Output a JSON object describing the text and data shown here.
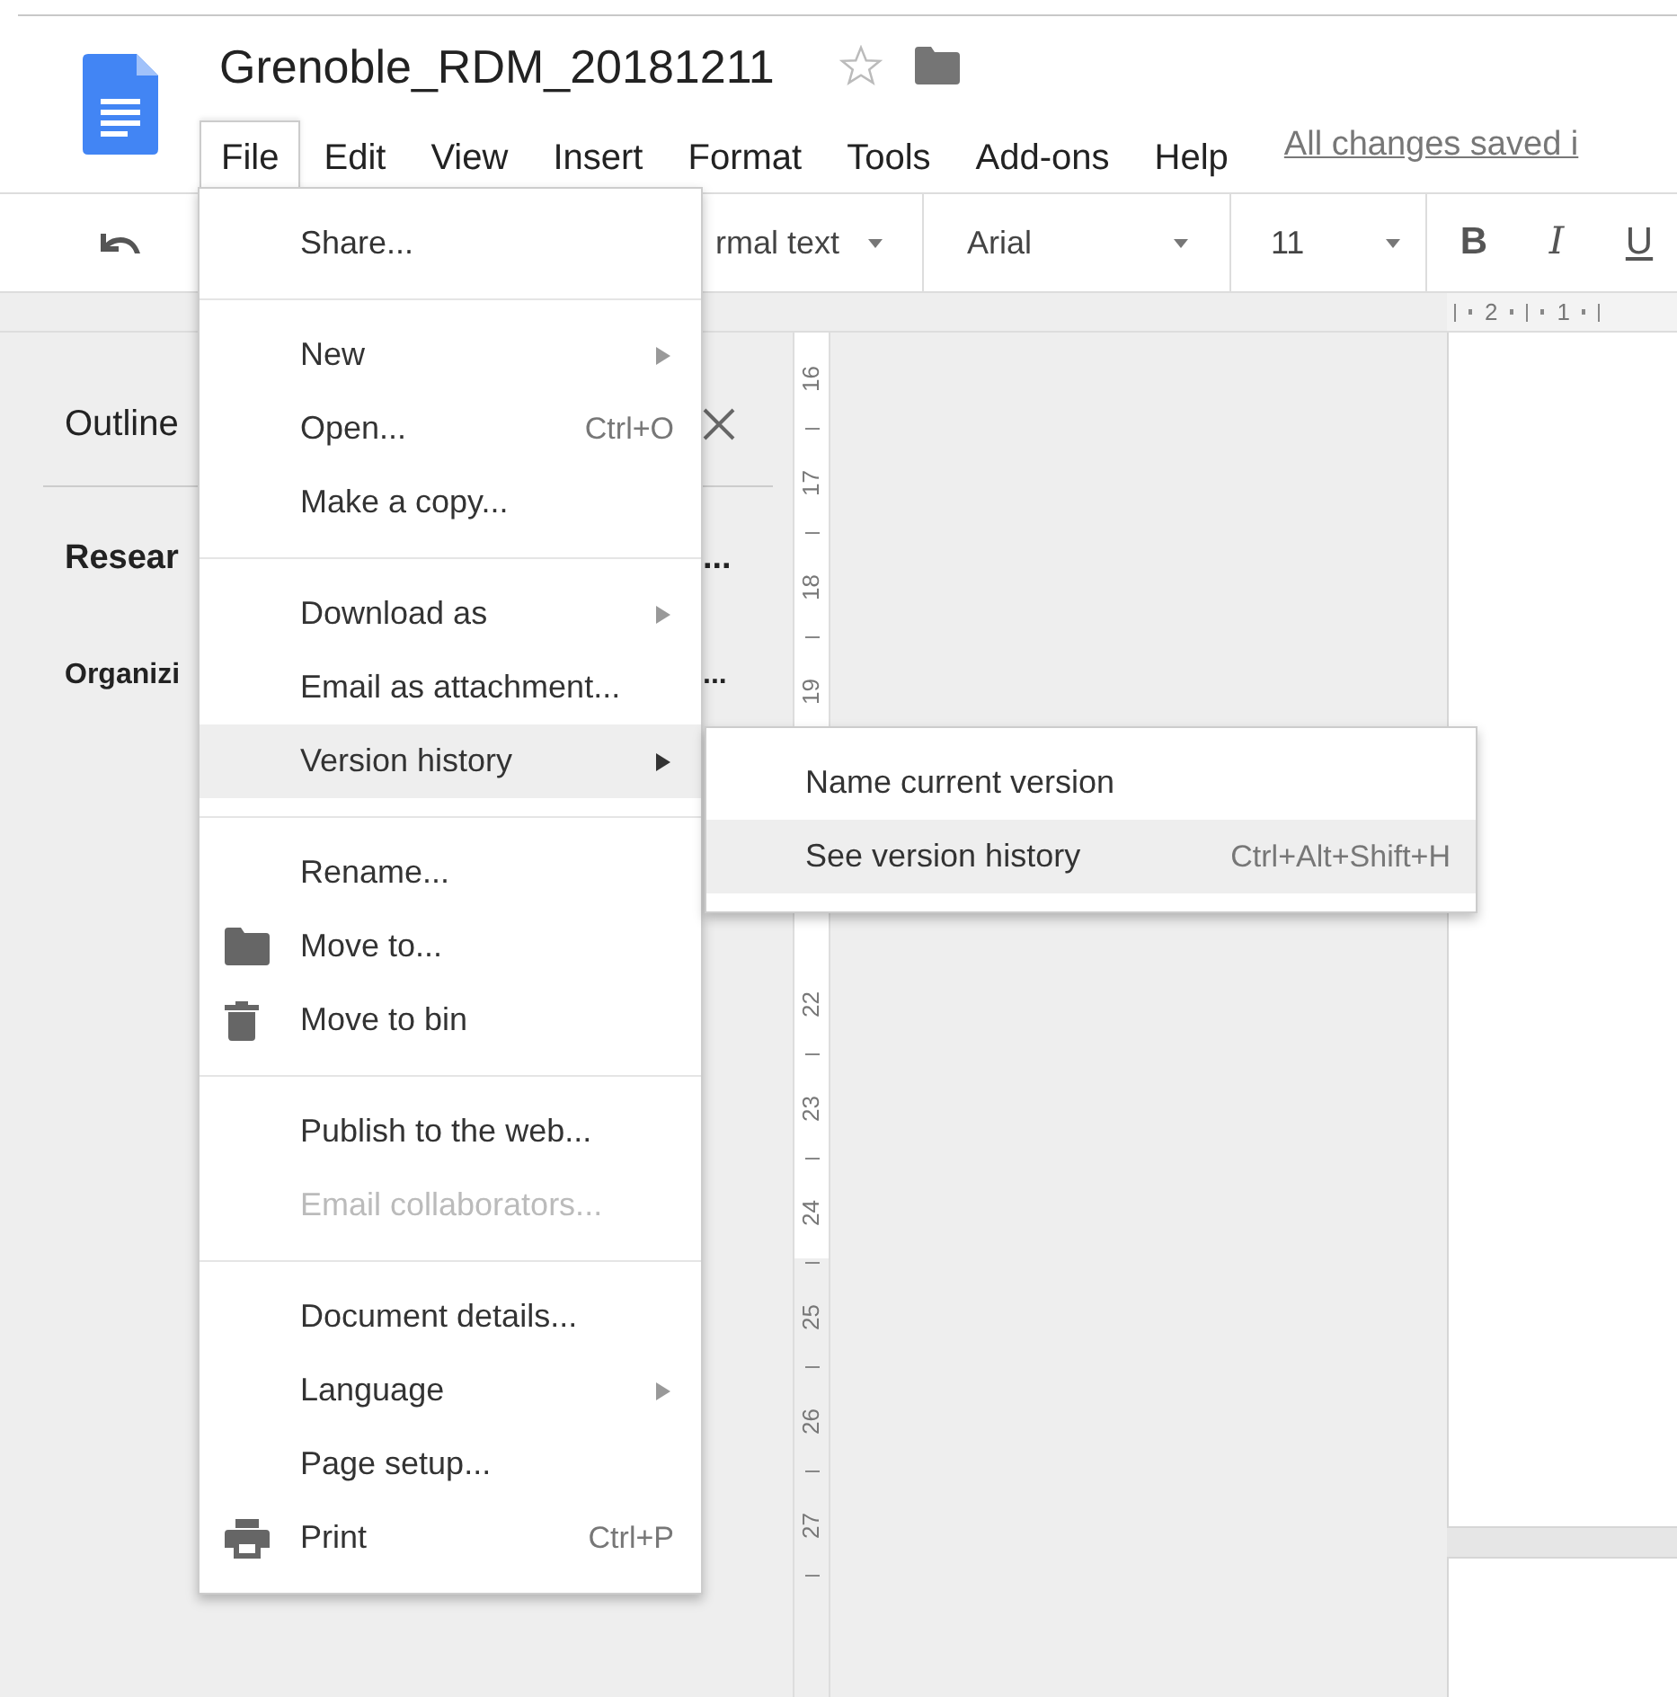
{
  "document": {
    "title": "Grenoble_RDM_20181211",
    "starred": false
  },
  "menu_bar": [
    {
      "label": "File",
      "selected": true
    },
    {
      "label": "Edit",
      "selected": false
    },
    {
      "label": "View",
      "selected": false
    },
    {
      "label": "Insert",
      "selected": false
    },
    {
      "label": "Format",
      "selected": false
    },
    {
      "label": "Tools",
      "selected": false
    },
    {
      "label": "Add-ons",
      "selected": false
    },
    {
      "label": "Help",
      "selected": false
    }
  ],
  "save_status": "All changes saved i",
  "toolbar": {
    "style": "rmal text",
    "font": "Arial",
    "size": "11",
    "format_buttons": [
      {
        "kind": "bold",
        "label": "B"
      },
      {
        "kind": "italic",
        "label": "I"
      },
      {
        "kind": "underline",
        "label": "U"
      }
    ]
  },
  "horizontal_ruler": [
    "2",
    "1"
  ],
  "outline": {
    "title": "Outline",
    "headings": [
      {
        "kind": "title",
        "left": "Resear",
        "right": "..."
      },
      {
        "kind": "subtitle",
        "left": "Organizi",
        "right": "..."
      }
    ]
  },
  "vertical_ruler": [
    {
      "label": "16",
      "gap_before": false
    },
    {
      "label": "17",
      "gap_before": false
    },
    {
      "label": "18",
      "gap_before": false
    },
    {
      "label": "19",
      "gap_before": false
    },
    {
      "label": "22",
      "gap_before": true
    },
    {
      "label": "23",
      "gap_before": false
    },
    {
      "label": "24",
      "gap_before": false
    },
    {
      "label": "25",
      "gap_before": false
    },
    {
      "label": "26",
      "gap_before": false
    },
    {
      "label": "27",
      "gap_before": false
    }
  ],
  "file_menu": [
    [
      {
        "label": "Share...",
        "selected": false,
        "disabled": false
      }
    ],
    [
      {
        "label": "New",
        "selected": false,
        "disabled": false,
        "submenu": true
      },
      {
        "label": "Open...",
        "shortcut": "Ctrl+O",
        "selected": false,
        "disabled": false
      },
      {
        "label": "Make a copy...",
        "selected": false,
        "disabled": false
      }
    ],
    [
      {
        "label": "Download as",
        "selected": false,
        "disabled": false,
        "submenu": true
      },
      {
        "label": "Email as attachment...",
        "selected": false,
        "disabled": false
      },
      {
        "label": "Version history",
        "selected": true,
        "disabled": false,
        "submenu": true
      }
    ],
    [
      {
        "label": "Rename...",
        "selected": false,
        "disabled": false
      },
      {
        "label": "Move to...",
        "kind": "folder",
        "selected": false,
        "disabled": false
      },
      {
        "label": "Move to bin",
        "kind": "trash",
        "selected": false,
        "disabled": false
      }
    ],
    [
      {
        "label": "Publish to the web...",
        "selected": false,
        "disabled": false
      },
      {
        "label": "Email collaborators...",
        "selected": false,
        "disabled": true
      }
    ],
    [
      {
        "label": "Document details...",
        "selected": false,
        "disabled": false
      },
      {
        "label": "Language",
        "selected": false,
        "disabled": false,
        "submenu": true
      },
      {
        "label": "Page setup...",
        "selected": false,
        "disabled": false
      },
      {
        "label": "Print",
        "kind": "print",
        "shortcut": "Ctrl+P",
        "selected": false,
        "disabled": false
      }
    ]
  ],
  "version_submenu": [
    {
      "label": "Name current version",
      "selected": false
    },
    {
      "label": "See version history",
      "shortcut": "Ctrl+Alt+Shift+H",
      "selected": true
    }
  ]
}
